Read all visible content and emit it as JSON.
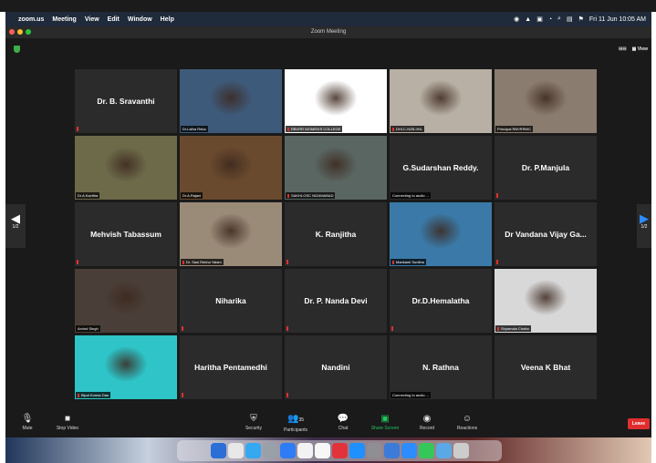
{
  "menubar": {
    "app": "zoom.us",
    "menus": [
      "Meeting",
      "View",
      "Edit",
      "Window",
      "Help"
    ],
    "clock": "Fri 11 Jun  10:05 AM"
  },
  "window": {
    "title": "Zoom Meeting"
  },
  "view": {
    "speaker_label": "",
    "gallery_label": "View"
  },
  "pagination": {
    "left_page": "1/2",
    "right_page": "1/2"
  },
  "participants": [
    {
      "name": "Dr. B. Sravanthi",
      "label": "",
      "video": false,
      "muted": true
    },
    {
      "name": "",
      "label": "Dr.Latha Reka",
      "video": true,
      "muted": false,
      "active": true,
      "tone": "#3e5a7a"
    },
    {
      "name": "",
      "label": "RBVRR WOMEN'S COLLEGE",
      "video": true,
      "muted": true,
      "tone": "#ffffff"
    },
    {
      "name": "",
      "label": "DHLC-NZB-IIHL",
      "video": true,
      "muted": true,
      "tone": "#b8b0a4"
    },
    {
      "name": "",
      "label": "Principal RBVRRWC",
      "video": true,
      "muted": false,
      "tone": "#8a7c6e"
    },
    {
      "name": "",
      "label": "Dr.A.Kavitha",
      "video": true,
      "muted": false,
      "tone": "#6d6a4a"
    },
    {
      "name": "",
      "label": "Dr.A.Rajani",
      "video": true,
      "muted": false,
      "tone": "#6a4a2e"
    },
    {
      "name": "",
      "label": "SAKHI-OSC NIZAMABAD",
      "video": true,
      "muted": true,
      "tone": "#5a6662"
    },
    {
      "name": "G.Sudarshan Reddy.",
      "label": "Connecting to audio ...",
      "video": false,
      "muted": false
    },
    {
      "name": "Dr. P.Manjula",
      "label": "",
      "video": false,
      "muted": true
    },
    {
      "name": "Mehvish Tabassum",
      "label": "",
      "video": false,
      "muted": true
    },
    {
      "name": "",
      "label": "Dr. Sasi Rekha Yalam",
      "video": true,
      "muted": true,
      "tone": "#9a8a78"
    },
    {
      "name": "K. Ranjitha",
      "label": "",
      "video": false,
      "muted": true
    },
    {
      "name": "",
      "label": "Marikanti Sunitha",
      "video": true,
      "muted": true,
      "tone": "#3b7aa8"
    },
    {
      "name": "Dr Vandana Vijay Ga...",
      "label": "",
      "video": false,
      "muted": true
    },
    {
      "name": "",
      "label": "Arvind Singh",
      "video": true,
      "muted": false,
      "tone": "#4a3f38"
    },
    {
      "name": "Niharika",
      "label": "",
      "video": false,
      "muted": true
    },
    {
      "name": "Dr. P. Nanda Devi",
      "label": "",
      "video": false,
      "muted": true
    },
    {
      "name": "Dr.D.Hemalatha",
      "label": "",
      "video": false,
      "muted": true
    },
    {
      "name": "",
      "label": "Shyamala Chotta",
      "video": true,
      "muted": true,
      "tone": "#d8d8d8"
    },
    {
      "name": "",
      "label": "Bipul Kumar Das",
      "video": true,
      "muted": true,
      "tone": "#2ec4c8"
    },
    {
      "name": "Haritha Pentamedhi",
      "label": "",
      "video": false,
      "muted": true
    },
    {
      "name": "Nandini",
      "label": "",
      "video": false,
      "muted": true
    },
    {
      "name": "N. Rathna",
      "label": "Connecting to audio ...",
      "video": false,
      "muted": false
    },
    {
      "name": "Veena K Bhat",
      "label": "",
      "video": false,
      "muted": false
    }
  ],
  "toolbar": {
    "mute": "Mute",
    "stop_video": "Stop Video",
    "security": "Security",
    "participants": "Participants",
    "participants_count": "35",
    "chat": "Chat",
    "share_screen": "Share Screen",
    "record": "Record",
    "reactions": "Reactions",
    "leave": "Leave"
  },
  "dock_colors": [
    "#2b6fd6",
    "#e8e8e8",
    "#34a8f0",
    "#9aa0a8",
    "#2e7cf6",
    "#f2f2f2",
    "#f7f7f7",
    "#e2333c",
    "#1e90ff",
    "#8e8e93",
    "#3c7bd8",
    "#2d8cff",
    "#35c759",
    "#5aa9e6",
    "#cccccc"
  ]
}
